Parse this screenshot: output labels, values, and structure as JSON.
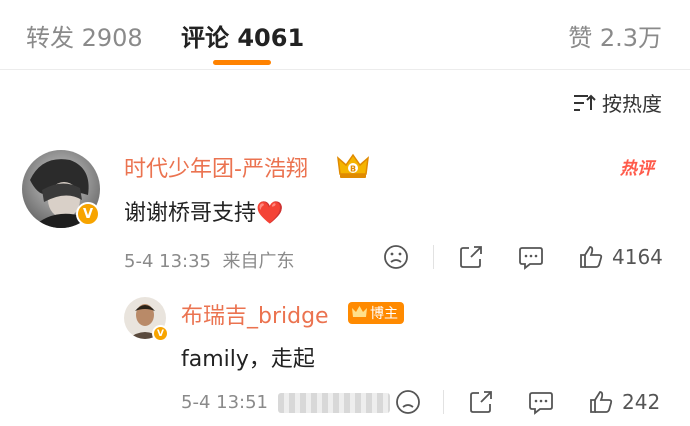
{
  "tabs": {
    "repost": "转发 2908",
    "comments": "评论 4061",
    "likes": "赞 2.3万"
  },
  "sort": {
    "label": "按热度"
  },
  "comments": [
    {
      "username": "时代少年团-严浩翔",
      "text": "谢谢桥哥支持",
      "emoji": "❤️",
      "time": "5-4 13:35",
      "location": "来自广东",
      "hot_label": "热评",
      "likes": "4164"
    }
  ],
  "reply": {
    "username": "布瑞吉_bridge",
    "badge": "博主",
    "text": "family，走起",
    "time": "5-4 13:51",
    "likes": "242"
  },
  "colors": {
    "accent": "#ff8200",
    "username": "#eb7350",
    "verified": "#f7a400",
    "hot": "#ff5a4a"
  }
}
